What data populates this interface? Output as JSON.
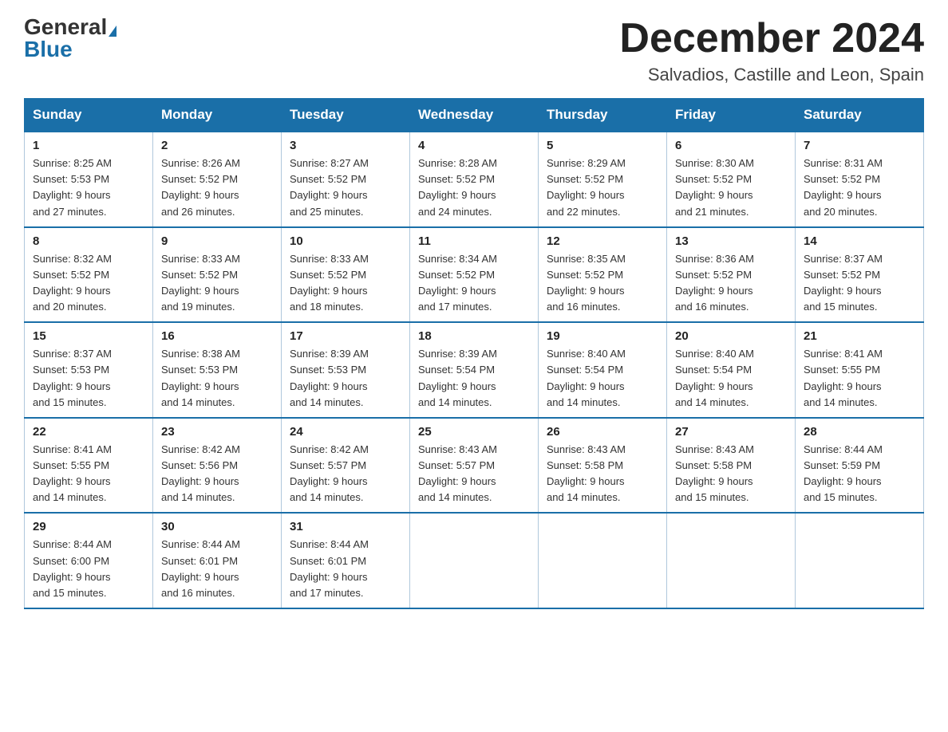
{
  "logo": {
    "general": "General",
    "blue": "Blue"
  },
  "header": {
    "month_year": "December 2024",
    "location": "Salvadios, Castille and Leon, Spain"
  },
  "weekdays": [
    "Sunday",
    "Monday",
    "Tuesday",
    "Wednesday",
    "Thursday",
    "Friday",
    "Saturday"
  ],
  "weeks": [
    [
      {
        "day": "1",
        "sunrise": "8:25 AM",
        "sunset": "5:53 PM",
        "daylight": "9 hours and 27 minutes."
      },
      {
        "day": "2",
        "sunrise": "8:26 AM",
        "sunset": "5:52 PM",
        "daylight": "9 hours and 26 minutes."
      },
      {
        "day": "3",
        "sunrise": "8:27 AM",
        "sunset": "5:52 PM",
        "daylight": "9 hours and 25 minutes."
      },
      {
        "day": "4",
        "sunrise": "8:28 AM",
        "sunset": "5:52 PM",
        "daylight": "9 hours and 24 minutes."
      },
      {
        "day": "5",
        "sunrise": "8:29 AM",
        "sunset": "5:52 PM",
        "daylight": "9 hours and 22 minutes."
      },
      {
        "day": "6",
        "sunrise": "8:30 AM",
        "sunset": "5:52 PM",
        "daylight": "9 hours and 21 minutes."
      },
      {
        "day": "7",
        "sunrise": "8:31 AM",
        "sunset": "5:52 PM",
        "daylight": "9 hours and 20 minutes."
      }
    ],
    [
      {
        "day": "8",
        "sunrise": "8:32 AM",
        "sunset": "5:52 PM",
        "daylight": "9 hours and 20 minutes."
      },
      {
        "day": "9",
        "sunrise": "8:33 AM",
        "sunset": "5:52 PM",
        "daylight": "9 hours and 19 minutes."
      },
      {
        "day": "10",
        "sunrise": "8:33 AM",
        "sunset": "5:52 PM",
        "daylight": "9 hours and 18 minutes."
      },
      {
        "day": "11",
        "sunrise": "8:34 AM",
        "sunset": "5:52 PM",
        "daylight": "9 hours and 17 minutes."
      },
      {
        "day": "12",
        "sunrise": "8:35 AM",
        "sunset": "5:52 PM",
        "daylight": "9 hours and 16 minutes."
      },
      {
        "day": "13",
        "sunrise": "8:36 AM",
        "sunset": "5:52 PM",
        "daylight": "9 hours and 16 minutes."
      },
      {
        "day": "14",
        "sunrise": "8:37 AM",
        "sunset": "5:52 PM",
        "daylight": "9 hours and 15 minutes."
      }
    ],
    [
      {
        "day": "15",
        "sunrise": "8:37 AM",
        "sunset": "5:53 PM",
        "daylight": "9 hours and 15 minutes."
      },
      {
        "day": "16",
        "sunrise": "8:38 AM",
        "sunset": "5:53 PM",
        "daylight": "9 hours and 14 minutes."
      },
      {
        "day": "17",
        "sunrise": "8:39 AM",
        "sunset": "5:53 PM",
        "daylight": "9 hours and 14 minutes."
      },
      {
        "day": "18",
        "sunrise": "8:39 AM",
        "sunset": "5:54 PM",
        "daylight": "9 hours and 14 minutes."
      },
      {
        "day": "19",
        "sunrise": "8:40 AM",
        "sunset": "5:54 PM",
        "daylight": "9 hours and 14 minutes."
      },
      {
        "day": "20",
        "sunrise": "8:40 AM",
        "sunset": "5:54 PM",
        "daylight": "9 hours and 14 minutes."
      },
      {
        "day": "21",
        "sunrise": "8:41 AM",
        "sunset": "5:55 PM",
        "daylight": "9 hours and 14 minutes."
      }
    ],
    [
      {
        "day": "22",
        "sunrise": "8:41 AM",
        "sunset": "5:55 PM",
        "daylight": "9 hours and 14 minutes."
      },
      {
        "day": "23",
        "sunrise": "8:42 AM",
        "sunset": "5:56 PM",
        "daylight": "9 hours and 14 minutes."
      },
      {
        "day": "24",
        "sunrise": "8:42 AM",
        "sunset": "5:57 PM",
        "daylight": "9 hours and 14 minutes."
      },
      {
        "day": "25",
        "sunrise": "8:43 AM",
        "sunset": "5:57 PM",
        "daylight": "9 hours and 14 minutes."
      },
      {
        "day": "26",
        "sunrise": "8:43 AM",
        "sunset": "5:58 PM",
        "daylight": "9 hours and 14 minutes."
      },
      {
        "day": "27",
        "sunrise": "8:43 AM",
        "sunset": "5:58 PM",
        "daylight": "9 hours and 15 minutes."
      },
      {
        "day": "28",
        "sunrise": "8:44 AM",
        "sunset": "5:59 PM",
        "daylight": "9 hours and 15 minutes."
      }
    ],
    [
      {
        "day": "29",
        "sunrise": "8:44 AM",
        "sunset": "6:00 PM",
        "daylight": "9 hours and 15 minutes."
      },
      {
        "day": "30",
        "sunrise": "8:44 AM",
        "sunset": "6:01 PM",
        "daylight": "9 hours and 16 minutes."
      },
      {
        "day": "31",
        "sunrise": "8:44 AM",
        "sunset": "6:01 PM",
        "daylight": "9 hours and 17 minutes."
      },
      null,
      null,
      null,
      null
    ]
  ],
  "labels": {
    "sunrise": "Sunrise: ",
    "sunset": "Sunset: ",
    "daylight": "Daylight: "
  }
}
